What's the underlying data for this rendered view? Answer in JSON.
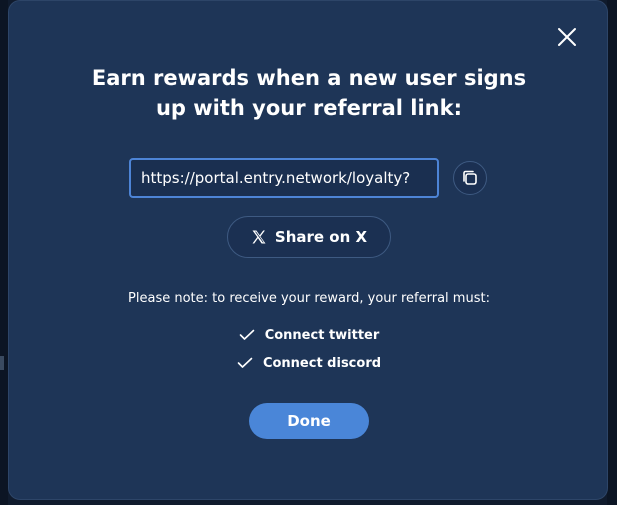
{
  "dialog": {
    "title_line1": "Earn rewards when a new user signs",
    "title_line2": "up with your referral link:",
    "referral_link": "https://portal.entry.network/loyalty?",
    "share_label": "Share on X",
    "note": "Please note: to receive your reward, your referral must:",
    "requirements": [
      {
        "label": "Connect twitter"
      },
      {
        "label": "Connect discord"
      }
    ],
    "done_label": "Done"
  },
  "icons": {
    "close": "close-icon",
    "copy": "copy-icon",
    "share": "x-logo-icon",
    "check": "checkmark-icon"
  },
  "colors": {
    "modal_bg": "#1e3557",
    "accent": "#4a86d8",
    "input_border": "#4d84d6",
    "text": "#ffffff"
  }
}
